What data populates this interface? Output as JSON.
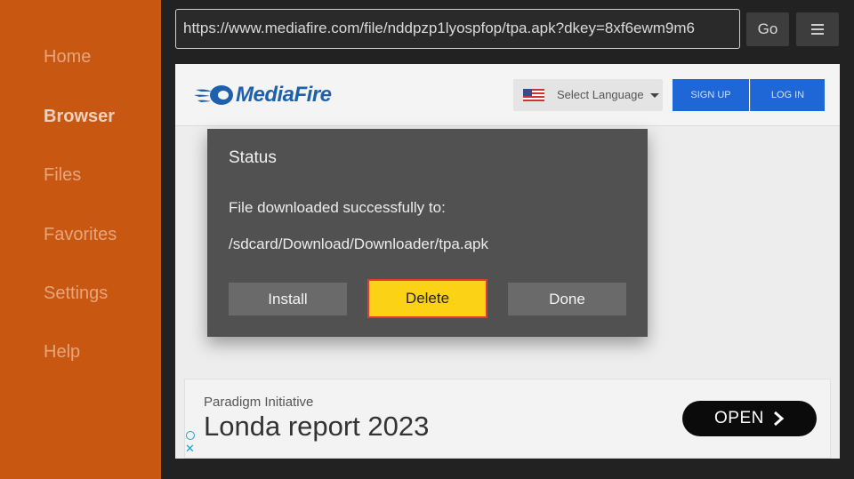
{
  "sidebar": {
    "items": [
      {
        "label": "Home",
        "active": false
      },
      {
        "label": "Browser",
        "active": true
      },
      {
        "label": "Files",
        "active": false
      },
      {
        "label": "Favorites",
        "active": false
      },
      {
        "label": "Settings",
        "active": false
      },
      {
        "label": "Help",
        "active": false
      }
    ]
  },
  "addressbar": {
    "url": "https://www.mediafire.com/file/nddpzp1lyospfop/tpa.apk?dkey=8xf6ewm9m6",
    "go_label": "Go",
    "menu_icon": "menu-icon"
  },
  "webpage": {
    "logo_text": "MediaFire",
    "language_label": "Select Language",
    "signup_label": "SIGN UP",
    "login_label": "LOG IN"
  },
  "dialog": {
    "title": "Status",
    "message": "File downloaded successfully to:",
    "path": "/sdcard/Download/Downloader/tpa.apk",
    "install_label": "Install",
    "delete_label": "Delete",
    "done_label": "Done"
  },
  "ad": {
    "sponsor": "Paradigm Initiative",
    "title": "Londa report 2023",
    "cta_label": "OPEN"
  },
  "colors": {
    "sidebar": "#c85712",
    "accent_highlight": "#fcd216",
    "highlight_border": "#e83a2a",
    "brand_blue": "#1f66d6"
  }
}
